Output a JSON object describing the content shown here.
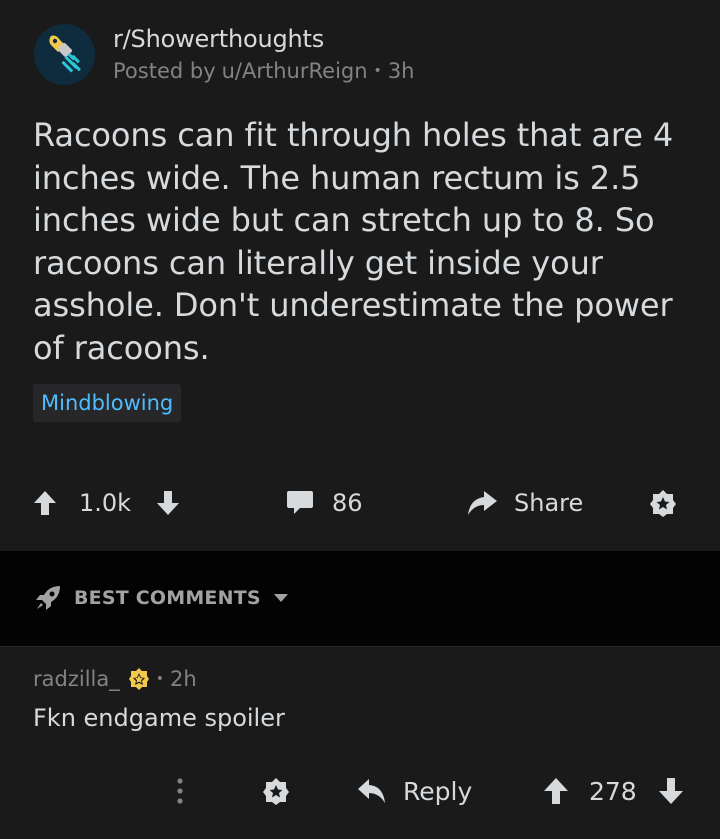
{
  "post": {
    "subreddit": "r/Showerthoughts",
    "posted_by_prefix": "Posted by",
    "author": "u/ArthurReign",
    "age": "3h",
    "title": "Racoons can fit through holes that are 4 inches wide. The human rectum is 2.5 inches wide but can stretch up to 8. So racoons can literally get inside your asshole. Don't underestimate the power of racoons.",
    "flair": "Mindblowing",
    "score": "1.0k",
    "comments": "86",
    "share_label": "Share"
  },
  "sort": {
    "label": "BEST COMMENTS"
  },
  "comment": {
    "author": "radzilla_",
    "age": "2h",
    "body": "Fkn endgame spoiler",
    "reply_label": "Reply",
    "score": "278"
  },
  "colors": {
    "background": "#1a1a1b",
    "sort_bar": "#030303",
    "text": "#d7dadc",
    "meta": "#818384",
    "flair_text": "#4fbcff",
    "award_gold": "#f2c94c"
  }
}
